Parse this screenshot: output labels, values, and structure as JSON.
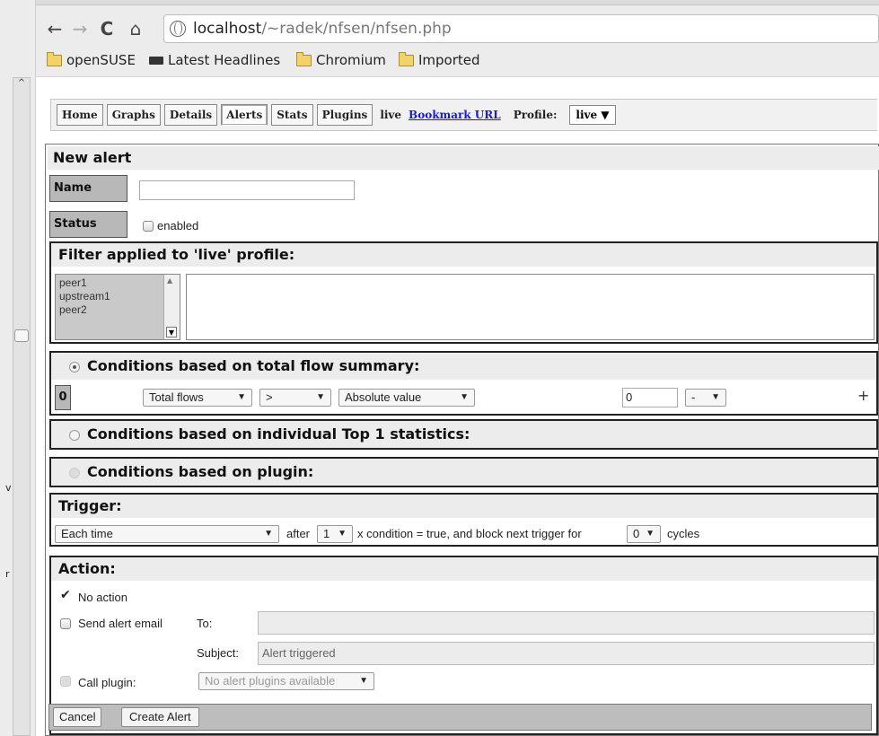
{
  "browser": {
    "url_host": "localhost",
    "url_path": "/~radek/nfsen/nfsen.php",
    "bookmarks": [
      "openSUSE",
      "Latest Headlines",
      "Chromium",
      "Imported"
    ]
  },
  "edge_letters": [
    "v",
    "r"
  ],
  "tabs": [
    "Home",
    "Graphs",
    "Details",
    "Alerts",
    "Stats",
    "Plugins"
  ],
  "tabs_extra": {
    "live_label": "live",
    "bookmark_url": "Bookmark URL",
    "profile_label": "Profile:",
    "profile_value": "live"
  },
  "new_alert": {
    "title": "New alert",
    "name_label": "Name",
    "name_value": "",
    "status_label": "Status",
    "status_option": "enabled"
  },
  "filter": {
    "title": "Filter applied to 'live' profile:",
    "channels": [
      "peer1",
      "upstream1",
      "peer2"
    ],
    "filter_text": ""
  },
  "conditions_flow": {
    "title": "Conditions based on total flow summary:",
    "row_index": "0",
    "type": "Total flows",
    "operator": ">",
    "comparison": "Absolute value",
    "value": "0",
    "unit": "-",
    "add_symbol": "+"
  },
  "conditions_top1": {
    "title": "Conditions based on individual Top 1 statistics:"
  },
  "conditions_plugin": {
    "title": "Conditions based on plugin:"
  },
  "trigger": {
    "title": "Trigger:",
    "type": "Each time",
    "after_label": "after",
    "after_value": "1",
    "mid_text": "x condition = true, and block next trigger for",
    "block_value": "0",
    "cycles_label": "cycles"
  },
  "action": {
    "title": "Action:",
    "no_action": "No action",
    "send_email": "Send alert email",
    "to_label": "To:",
    "to_value": "",
    "subject_label": "Subject:",
    "subject_value": "Alert triggered",
    "call_plugin": "Call plugin:",
    "plugin_select": "No alert plugins available"
  },
  "buttons": {
    "cancel": "Cancel",
    "create": "Create Alert"
  }
}
